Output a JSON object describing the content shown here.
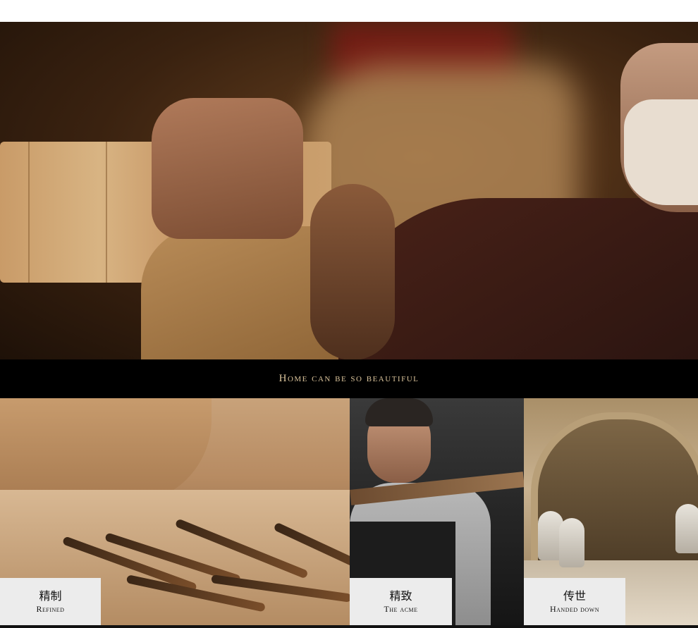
{
  "banner": {
    "text": "Home can be so beautiful"
  },
  "tiles": [
    {
      "zh": "精制",
      "en": "Refined"
    },
    {
      "zh": "精致",
      "en": "The acme"
    },
    {
      "zh": "传世",
      "en": "Handed down"
    }
  ],
  "colors": {
    "banner_bg": "#000000",
    "banner_text": "#d9c29a",
    "caption_bg": "#ececec"
  }
}
